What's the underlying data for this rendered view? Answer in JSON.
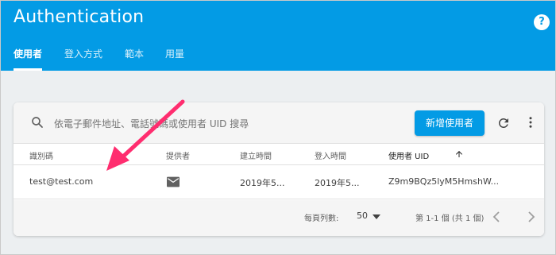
{
  "header": {
    "title": "Authentication",
    "help_label": "?",
    "tabs": [
      {
        "label": "使用者"
      },
      {
        "label": "登入方式"
      },
      {
        "label": "範本"
      },
      {
        "label": "用量"
      }
    ]
  },
  "toolbar": {
    "search_placeholder": "依電子郵件地址、電話號碼或使用者 UID 搜尋",
    "add_user_label": "新增使用者"
  },
  "table": {
    "columns": [
      "識別碼",
      "提供者",
      "建立時間",
      "登入時間",
      "使用者 UID"
    ],
    "sort_column": "使用者 UID",
    "sort_direction": "ascending",
    "rows": [
      {
        "identifier": "test@test.com",
        "provider_icon": "email-icon",
        "created": "2019年5...",
        "signed_in": "2019年5...",
        "uid": "Z9m9BQz5lyM5HmshW..."
      }
    ]
  },
  "pagination": {
    "rows_per_page_label": "每頁列數:",
    "rows_per_page_value": "50",
    "range_text": "第 1-1 個 (共 1 個)"
  },
  "colors": {
    "header": "#039be5",
    "arrow": "#ff2d6f"
  },
  "icons": [
    "search-icon",
    "refresh-icon",
    "more-vert-icon",
    "mail-icon",
    "arrow-upward-icon",
    "arrow-drop-down-icon",
    "chevron-left-icon",
    "chevron-right-icon",
    "help-icon"
  ]
}
